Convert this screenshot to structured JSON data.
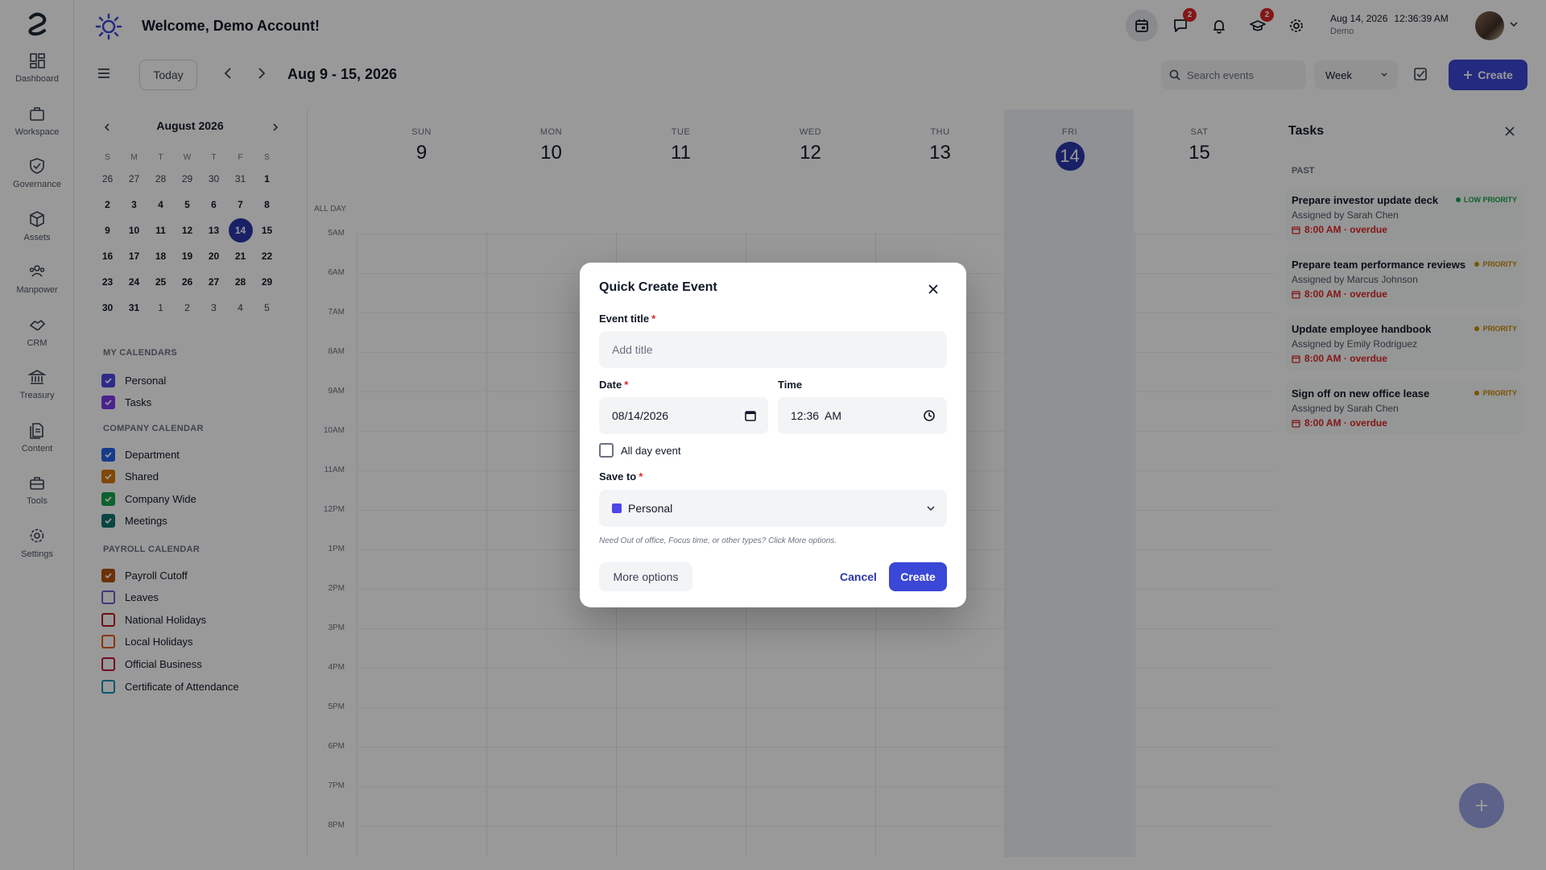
{
  "header": {
    "welcome": "Welcome, Demo Account!",
    "date": "Aug 14, 2026",
    "time": "12:36:39 AM",
    "account": "Demo",
    "messages_badge": "2",
    "learning_badge": "2"
  },
  "rail": {
    "items": [
      {
        "label": "Dashboard",
        "icon": "dashboard-icon"
      },
      {
        "label": "Workspace",
        "icon": "briefcase-icon"
      },
      {
        "label": "Governance",
        "icon": "shield-icon"
      },
      {
        "label": "Assets",
        "icon": "cube-icon"
      },
      {
        "label": "Manpower",
        "icon": "people-icon"
      },
      {
        "label": "CRM",
        "icon": "handshake-icon"
      },
      {
        "label": "Treasury",
        "icon": "bank-icon"
      },
      {
        "label": "Content",
        "icon": "document-icon"
      },
      {
        "label": "Tools",
        "icon": "toolbox-icon"
      },
      {
        "label": "Settings",
        "icon": "gear-icon"
      }
    ]
  },
  "toolbar": {
    "today": "Today",
    "range": "Aug 9 - 15, 2026",
    "search_placeholder": "Search events",
    "view": "Week",
    "create": "Create"
  },
  "mini": {
    "title": "August 2026",
    "dow": [
      "S",
      "M",
      "T",
      "W",
      "T",
      "F",
      "S"
    ],
    "days": [
      "26",
      "27",
      "28",
      "29",
      "30",
      "31",
      "1",
      "2",
      "3",
      "4",
      "5",
      "6",
      "7",
      "8",
      "9",
      "10",
      "11",
      "12",
      "13",
      "14",
      "15",
      "16",
      "17",
      "18",
      "19",
      "20",
      "21",
      "22",
      "23",
      "24",
      "25",
      "26",
      "27",
      "28",
      "29",
      "30",
      "31",
      "1",
      "2",
      "3",
      "4",
      "5"
    ]
  },
  "calendars": {
    "my_title": "MY CALENDARS",
    "my": [
      {
        "label": "Personal",
        "color": "#4f46e5",
        "checked": true
      },
      {
        "label": "Tasks",
        "color": "#7c3aed",
        "checked": true
      }
    ],
    "company_title": "COMPANY CALENDAR",
    "company": [
      {
        "label": "Department",
        "color": "#2563eb",
        "checked": true
      },
      {
        "label": "Shared",
        "color": "#d97706",
        "checked": true
      },
      {
        "label": "Company Wide",
        "color": "#16a34a",
        "checked": true
      },
      {
        "label": "Meetings",
        "color": "#0f766e",
        "checked": true
      }
    ],
    "payroll_title": "PAYROLL CALENDAR",
    "payroll": [
      {
        "label": "Payroll Cutoff",
        "color": "#b45309",
        "checked": true
      },
      {
        "label": "Leaves",
        "color": "#6d5dd3",
        "checked": false
      },
      {
        "label": "National Holidays",
        "color": "#b91c1c",
        "checked": false
      },
      {
        "label": "Local Holidays",
        "color": "#ea580c",
        "checked": false
      },
      {
        "label": "Official Business",
        "color": "#be123c",
        "checked": false
      },
      {
        "label": "Certificate of Attendance",
        "color": "#0891b2",
        "checked": false
      }
    ]
  },
  "week": {
    "days": [
      {
        "dow": "SUN",
        "num": "9"
      },
      {
        "dow": "MON",
        "num": "10"
      },
      {
        "dow": "TUE",
        "num": "11"
      },
      {
        "dow": "WED",
        "num": "12"
      },
      {
        "dow": "THU",
        "num": "13"
      },
      {
        "dow": "FRI",
        "num": "14"
      },
      {
        "dow": "SAT",
        "num": "15"
      }
    ],
    "all_day": "ALL DAY",
    "hours": [
      "5AM",
      "6AM",
      "7AM",
      "8AM",
      "9AM",
      "10AM",
      "11AM",
      "12PM",
      "1PM",
      "2PM",
      "3PM",
      "4PM",
      "5PM",
      "6PM",
      "7PM",
      "8PM"
    ]
  },
  "tasks": {
    "title": "Tasks",
    "section": "PAST",
    "items": [
      {
        "title": "Prepare investor update deck",
        "assigned": "Assigned by Sarah Chen",
        "due": "8:00 AM · overdue",
        "priority": "LOW PRIORITY",
        "priority_color": "#16a34a"
      },
      {
        "title": "Prepare team performance reviews",
        "assigned": "Assigned by Marcus Johnson",
        "due": "8:00 AM · overdue",
        "priority": "PRIORITY",
        "priority_color": "#ca8a04"
      },
      {
        "title": "Update employee handbook",
        "assigned": "Assigned by Emily Rodriguez",
        "due": "8:00 AM · overdue",
        "priority": "PRIORITY",
        "priority_color": "#ca8a04"
      },
      {
        "title": "Sign off on new office lease",
        "assigned": "Assigned by Sarah Chen",
        "due": "8:00 AM · overdue",
        "priority": "PRIORITY",
        "priority_color": "#ca8a04"
      }
    ]
  },
  "modal": {
    "title": "Quick Create Event",
    "event_title_label": "Event title",
    "event_title_placeholder": "Add title",
    "date_label": "Date",
    "date_value": "08/14/2026",
    "time_label": "Time",
    "time_value": "12:36  AM",
    "all_day": "All day event",
    "save_to_label": "Save to",
    "save_to_value": "Personal",
    "hint": "Need Out of office, Focus time, or other types? Click More options.",
    "more": "More options",
    "cancel": "Cancel",
    "create": "Create",
    "required_mark": "*"
  },
  "colors": {
    "accent": "#3b47d6",
    "today": "#2b36a8",
    "overdue": "#dc2626"
  }
}
